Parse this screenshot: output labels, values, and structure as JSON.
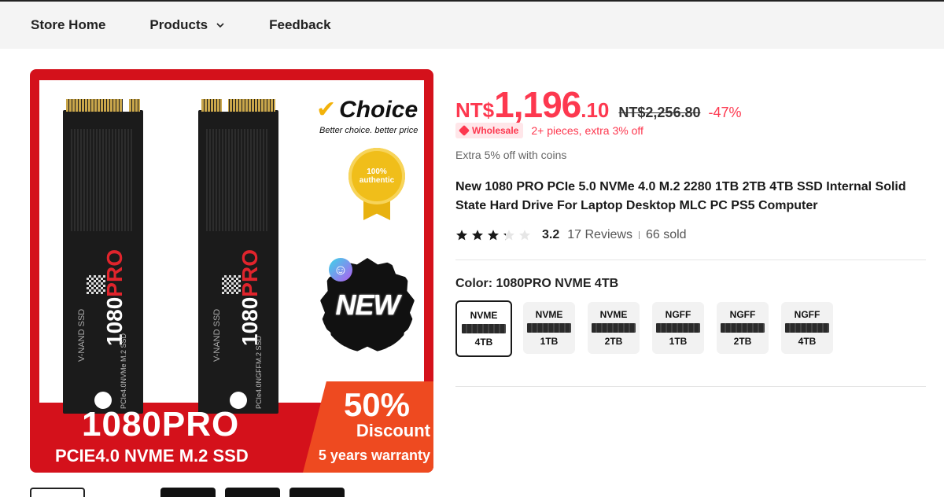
{
  "nav": {
    "items": [
      {
        "label": "Store Home"
      },
      {
        "label": "Products"
      },
      {
        "label": "Feedback"
      }
    ]
  },
  "gallery": {
    "choice_text": "Choice",
    "choice_sub": "Better choice. better price",
    "seal_line1": "100%",
    "seal_line2": "authentic",
    "new_badge": "NEW",
    "ssd_brand_a": "1080",
    "ssd_brand_b": "PRO",
    "ssd_left_sub": "PCIe4.0NVMe M.2 SSD",
    "ssd_right_sub": "PCIe4.0NGFFM.2 SSD",
    "ssd_vnand": "V-NAND SSD",
    "banner_title": "1080PRO",
    "banner_subtitle": "PCIE4.0 NVME M.2 SSD",
    "banner_percent": "50%",
    "banner_discount": "Discount",
    "banner_warranty": "5 years warranty"
  },
  "product": {
    "currency": "NT$",
    "price_int": "1,196",
    "price_dec": ".10",
    "original_price": "NT$2,256.80",
    "discount": "-47%",
    "wholesale_badge": "Wholesale",
    "wholesale_text": "2+ pieces, extra 3% off",
    "coins_text": "Extra 5% off with coins",
    "title": "New 1080 PRO PCIe 5.0 NVMe 4.0 M.2 2280 1TB 2TB 4TB SSD Internal Solid State Hard Drive For Laptop Desktop MLC PC PS5 Computer",
    "rating": 3.2,
    "rating_text": "3.2",
    "reviews": "17 Reviews",
    "sold": "66 sold",
    "color_label": "Color: 1080PRO NVME 4TB",
    "variants": [
      {
        "type": "NVME",
        "size": "4TB",
        "selected": true
      },
      {
        "type": "NVME",
        "size": "1TB",
        "selected": false
      },
      {
        "type": "NVME",
        "size": "2TB",
        "selected": false
      },
      {
        "type": "NGFF",
        "size": "1TB",
        "selected": false
      },
      {
        "type": "NGFF",
        "size": "2TB",
        "selected": false
      },
      {
        "type": "NGFF",
        "size": "4TB",
        "selected": false
      }
    ]
  },
  "colors": {
    "accent": "#fd384f",
    "banner_red": "#d4111b",
    "star": "#191919",
    "star_empty": "#e6e6e6"
  }
}
